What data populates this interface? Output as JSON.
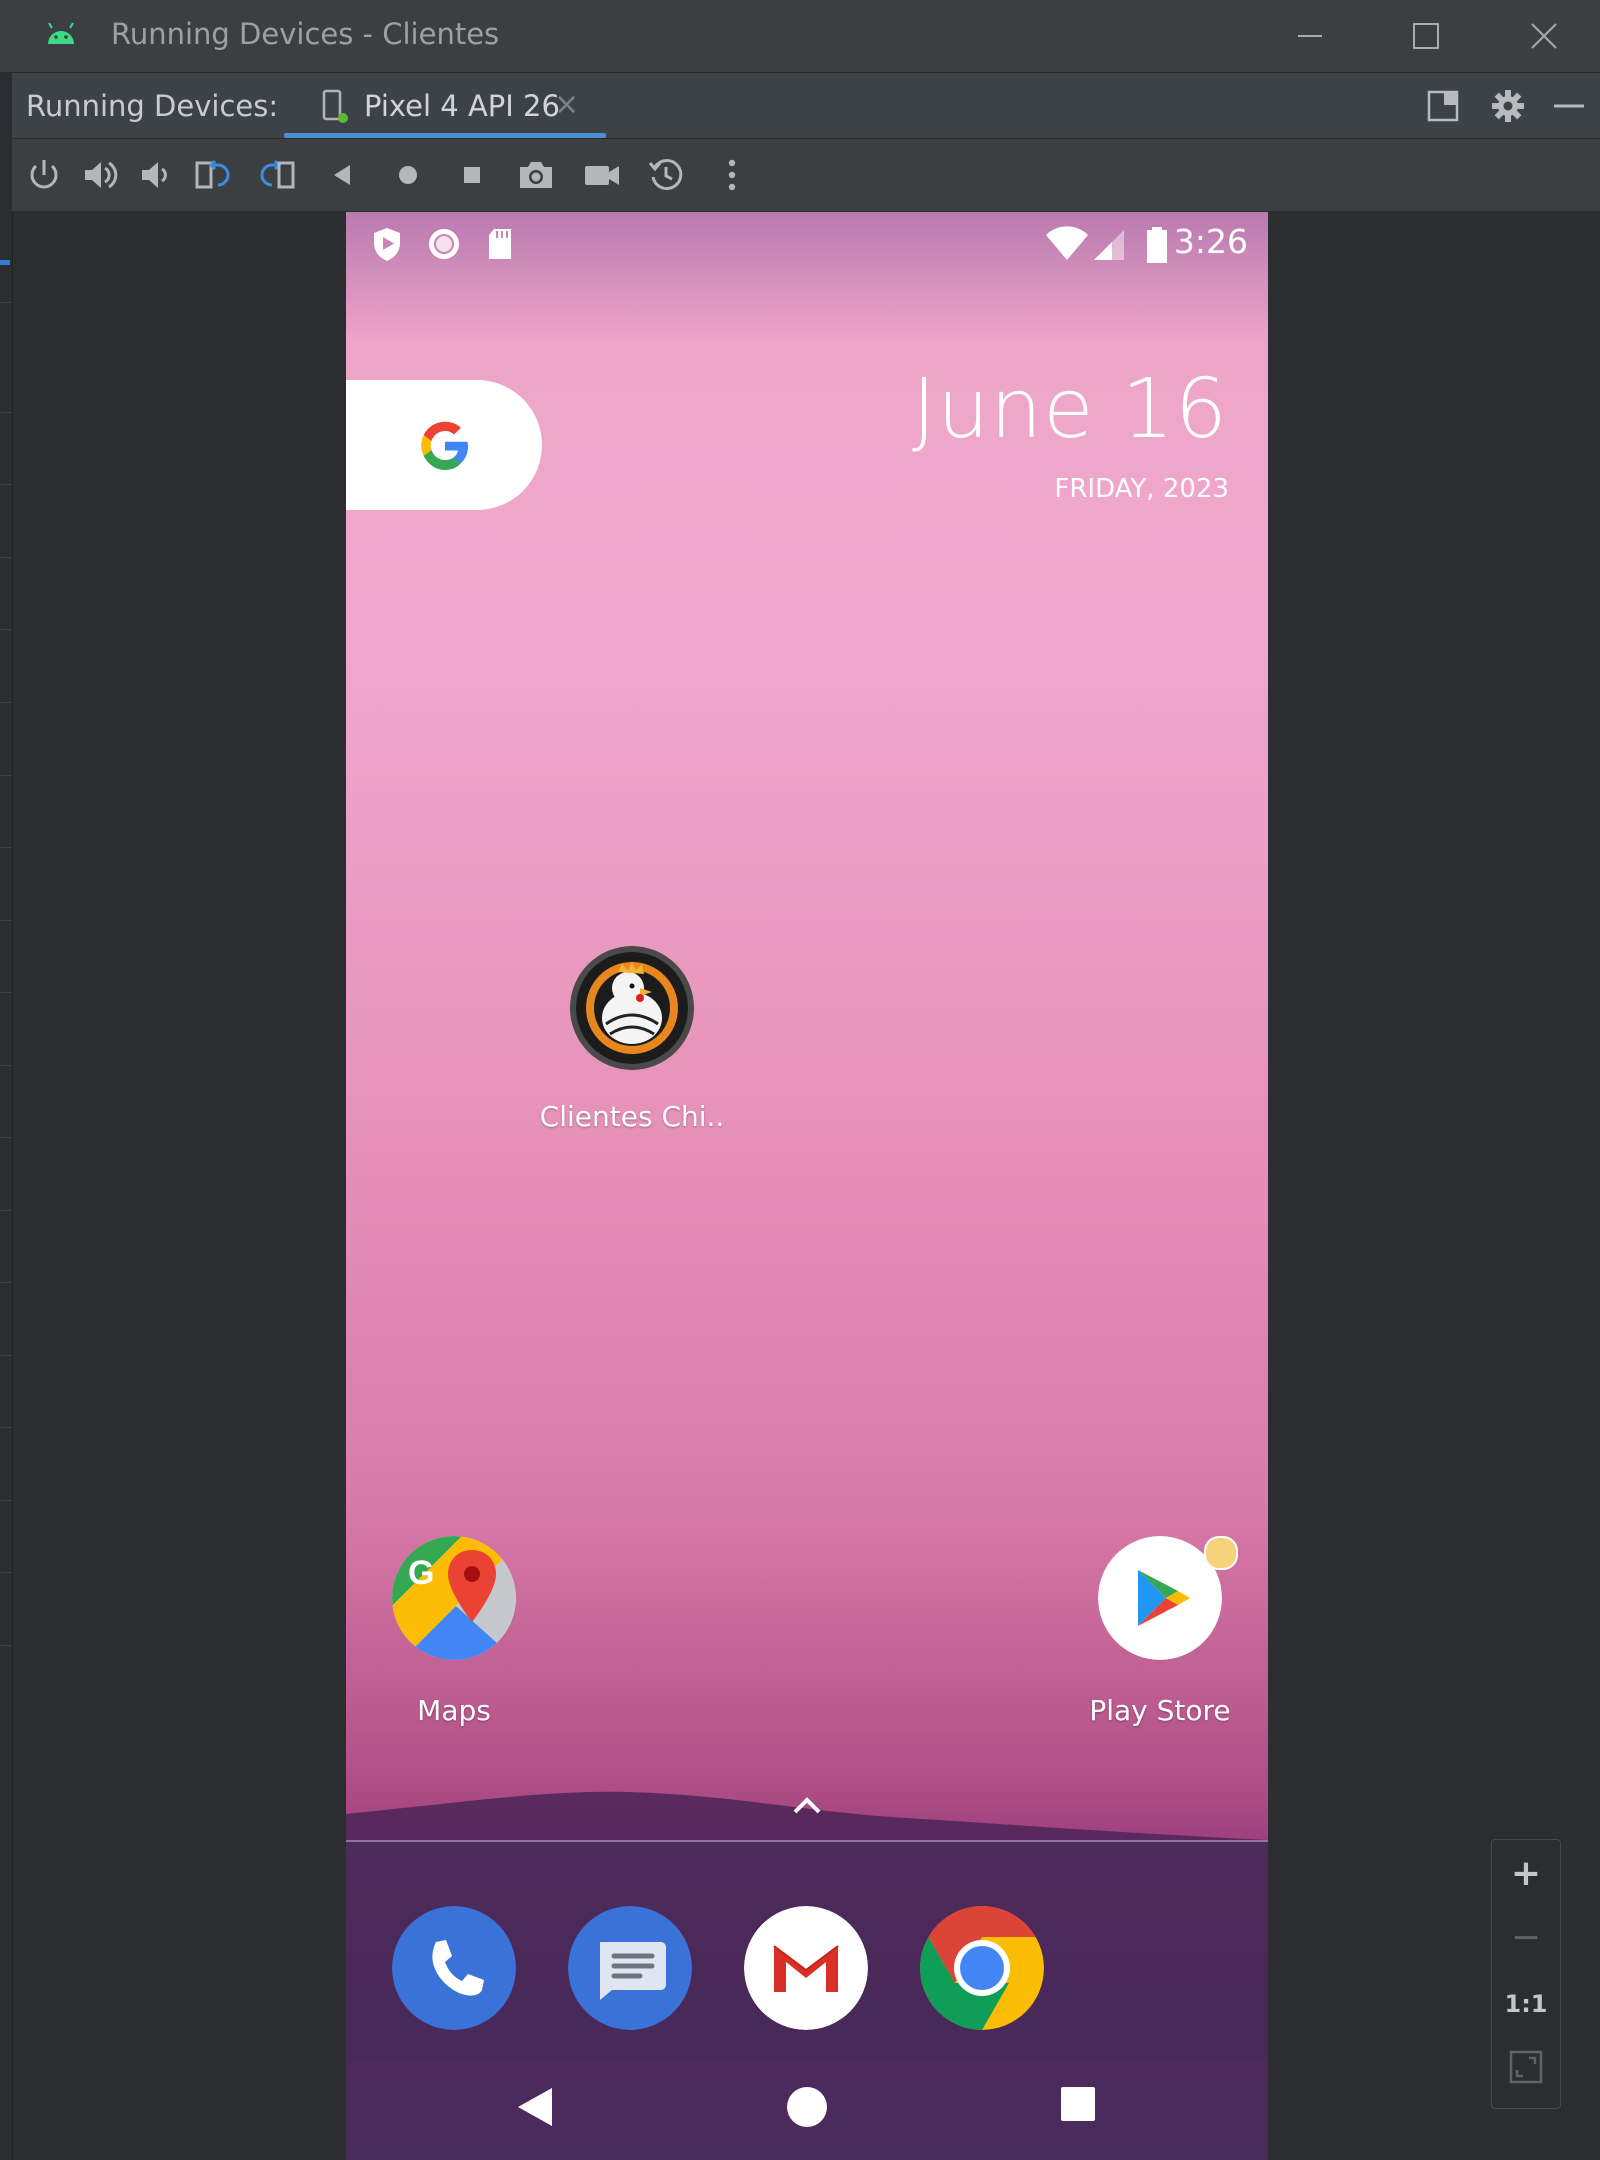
{
  "window": {
    "title": "Running Devices - Clientes",
    "icon": "android-icon",
    "controls": [
      "minimize-icon",
      "maximize-icon",
      "close-icon"
    ]
  },
  "tool_window": {
    "label": "Running Devices:",
    "tab": {
      "label": "Pixel 4 API 26",
      "icon": "device-icon",
      "close": "×"
    },
    "header_actions": [
      "layout-icon",
      "settings-gear-icon",
      "hide-icon"
    ]
  },
  "toolbar": {
    "buttons": [
      "power-icon",
      "volume-up-icon",
      "volume-down-icon",
      "rotate-left-icon",
      "rotate-right-icon",
      "back-icon",
      "home-icon",
      "overview-icon",
      "screenshot-icon",
      "screen-record-icon",
      "snapshot-restore-icon",
      "more-options-icon"
    ]
  },
  "device": {
    "status_bar": {
      "time": "3:26",
      "left_icons": [
        "play-protect-icon",
        "record-icon",
        "sd-card-icon"
      ],
      "right_icons": [
        "wifi-icon",
        "signal-icon",
        "battery-icon"
      ]
    },
    "date_widget": {
      "date": "June 16",
      "weekday_year": "FRIDAY, 2023"
    },
    "search_widget": {
      "icon": "google-g-icon"
    },
    "apps": [
      {
        "label": "Clientes Chi..",
        "icon": "clientes-chicken-logo-icon"
      },
      {
        "label": "Maps",
        "icon": "google-maps-icon"
      },
      {
        "label": "Play Store",
        "icon": "play-store-icon",
        "notification_dot": true
      }
    ],
    "dock": [
      "phone-icon",
      "messages-icon",
      "gmail-icon",
      "chrome-icon"
    ],
    "nav": [
      "nav-back-icon",
      "nav-home-icon",
      "nav-recents-icon"
    ],
    "colors": {
      "wallpaper_top": "#eda5c8",
      "wallpaper_bottom": "#4d2b5f",
      "play_dot": "#f6d27a"
    }
  },
  "zoom_controls": {
    "zoom_in": "+",
    "zoom_out": "−",
    "actual_size": "1:1",
    "fit": "fit-screen-icon"
  }
}
